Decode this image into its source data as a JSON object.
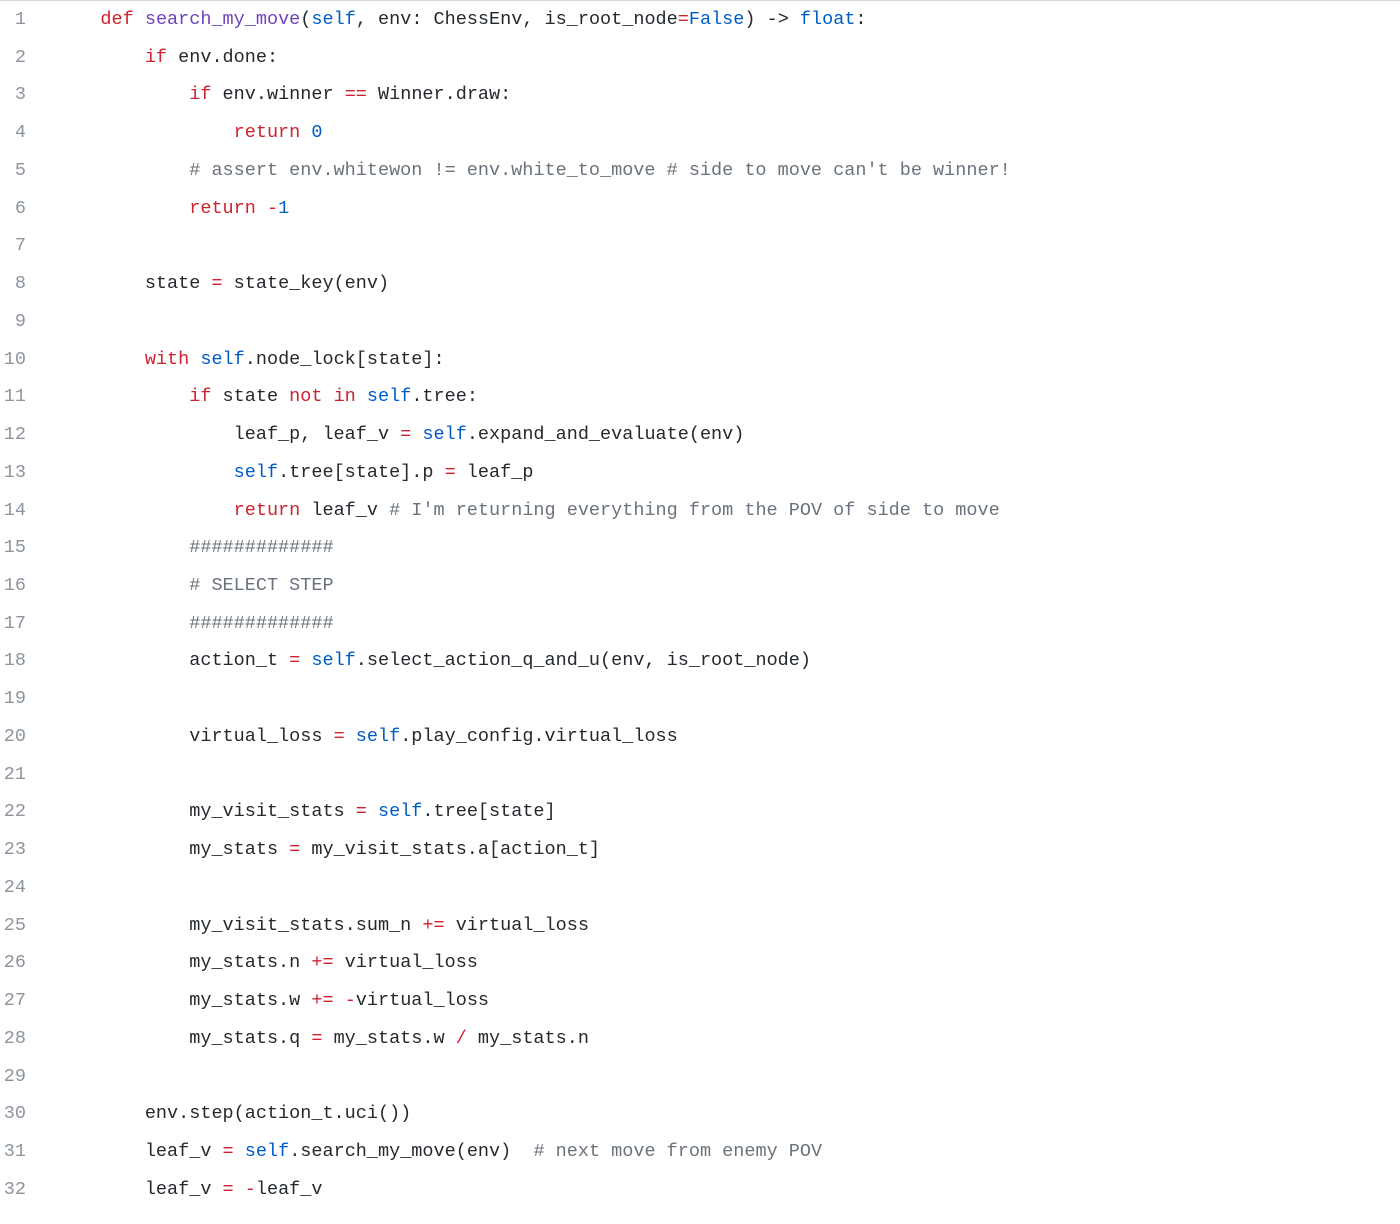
{
  "line_numbers": [
    "1",
    "2",
    "3",
    "4",
    "5",
    "6",
    "7",
    "8",
    "9",
    "10",
    "11",
    "12",
    "13",
    "14",
    "15",
    "16",
    "17",
    "18",
    "19",
    "20",
    "21",
    "22",
    "23",
    "24",
    "25",
    "26",
    "27",
    "28",
    "29",
    "30",
    "31",
    "32"
  ],
  "code": {
    "lines": [
      {
        "indent": "    ",
        "tokens": [
          {
            "cls": "kw",
            "t": "def "
          },
          {
            "cls": "fn",
            "t": "search_my_move"
          },
          {
            "cls": "txt",
            "t": "("
          },
          {
            "cls": "self",
            "t": "self"
          },
          {
            "cls": "txt",
            "t": ", env: ChessEnv, is_root_node"
          },
          {
            "cls": "op",
            "t": "="
          },
          {
            "cls": "const",
            "t": "False"
          },
          {
            "cls": "txt",
            "t": ") -> "
          },
          {
            "cls": "const",
            "t": "float"
          },
          {
            "cls": "txt",
            "t": ":"
          }
        ]
      },
      {
        "indent": "        ",
        "tokens": [
          {
            "cls": "kw",
            "t": "if"
          },
          {
            "cls": "txt",
            "t": " env.done:"
          }
        ]
      },
      {
        "indent": "            ",
        "tokens": [
          {
            "cls": "kw",
            "t": "if"
          },
          {
            "cls": "txt",
            "t": " env.winner "
          },
          {
            "cls": "op",
            "t": "=="
          },
          {
            "cls": "txt",
            "t": " Winner.draw:"
          }
        ]
      },
      {
        "indent": "                ",
        "tokens": [
          {
            "cls": "kw",
            "t": "return "
          },
          {
            "cls": "num",
            "t": "0"
          }
        ]
      },
      {
        "indent": "            ",
        "tokens": [
          {
            "cls": "cmt",
            "t": "# assert env.whitewon != env.white_to_move # side to move can't be winner!"
          }
        ]
      },
      {
        "indent": "            ",
        "tokens": [
          {
            "cls": "kw",
            "t": "return "
          },
          {
            "cls": "op",
            "t": "-"
          },
          {
            "cls": "num",
            "t": "1"
          }
        ]
      },
      {
        "indent": "",
        "tokens": []
      },
      {
        "indent": "        ",
        "tokens": [
          {
            "cls": "txt",
            "t": "state "
          },
          {
            "cls": "op",
            "t": "="
          },
          {
            "cls": "txt",
            "t": " state_key(env)"
          }
        ]
      },
      {
        "indent": "",
        "tokens": []
      },
      {
        "indent": "        ",
        "tokens": [
          {
            "cls": "kw",
            "t": "with "
          },
          {
            "cls": "self",
            "t": "self"
          },
          {
            "cls": "txt",
            "t": ".node_lock[state]:"
          }
        ]
      },
      {
        "indent": "            ",
        "tokens": [
          {
            "cls": "kw",
            "t": "if"
          },
          {
            "cls": "txt",
            "t": " state "
          },
          {
            "cls": "kw",
            "t": "not in "
          },
          {
            "cls": "self",
            "t": "self"
          },
          {
            "cls": "txt",
            "t": ".tree:"
          }
        ]
      },
      {
        "indent": "                ",
        "tokens": [
          {
            "cls": "txt",
            "t": "leaf_p, leaf_v "
          },
          {
            "cls": "op",
            "t": "="
          },
          {
            "cls": "txt",
            "t": " "
          },
          {
            "cls": "self",
            "t": "self"
          },
          {
            "cls": "txt",
            "t": ".expand_and_evaluate(env)"
          }
        ]
      },
      {
        "indent": "                ",
        "tokens": [
          {
            "cls": "self",
            "t": "self"
          },
          {
            "cls": "txt",
            "t": ".tree[state].p "
          },
          {
            "cls": "op",
            "t": "="
          },
          {
            "cls": "txt",
            "t": " leaf_p"
          }
        ]
      },
      {
        "indent": "                ",
        "tokens": [
          {
            "cls": "kw",
            "t": "return"
          },
          {
            "cls": "txt",
            "t": " leaf_v "
          },
          {
            "cls": "cmt",
            "t": "# I'm returning everything from the POV of side to move"
          }
        ]
      },
      {
        "indent": "            ",
        "tokens": [
          {
            "cls": "cmt",
            "t": "#############"
          }
        ]
      },
      {
        "indent": "            ",
        "tokens": [
          {
            "cls": "cmt",
            "t": "# SELECT STEP"
          }
        ]
      },
      {
        "indent": "            ",
        "tokens": [
          {
            "cls": "cmt",
            "t": "#############"
          }
        ]
      },
      {
        "indent": "            ",
        "tokens": [
          {
            "cls": "txt",
            "t": "action_t "
          },
          {
            "cls": "op",
            "t": "="
          },
          {
            "cls": "txt",
            "t": " "
          },
          {
            "cls": "self",
            "t": "self"
          },
          {
            "cls": "txt",
            "t": ".select_action_q_and_u(env, is_root_node)"
          }
        ]
      },
      {
        "indent": "",
        "tokens": []
      },
      {
        "indent": "            ",
        "tokens": [
          {
            "cls": "txt",
            "t": "virtual_loss "
          },
          {
            "cls": "op",
            "t": "="
          },
          {
            "cls": "txt",
            "t": " "
          },
          {
            "cls": "self",
            "t": "self"
          },
          {
            "cls": "txt",
            "t": ".play_config.virtual_loss"
          }
        ]
      },
      {
        "indent": "",
        "tokens": []
      },
      {
        "indent": "            ",
        "tokens": [
          {
            "cls": "txt",
            "t": "my_visit_stats "
          },
          {
            "cls": "op",
            "t": "="
          },
          {
            "cls": "txt",
            "t": " "
          },
          {
            "cls": "self",
            "t": "self"
          },
          {
            "cls": "txt",
            "t": ".tree[state]"
          }
        ]
      },
      {
        "indent": "            ",
        "tokens": [
          {
            "cls": "txt",
            "t": "my_stats "
          },
          {
            "cls": "op",
            "t": "="
          },
          {
            "cls": "txt",
            "t": " my_visit_stats.a[action_t]"
          }
        ]
      },
      {
        "indent": "",
        "tokens": []
      },
      {
        "indent": "            ",
        "tokens": [
          {
            "cls": "txt",
            "t": "my_visit_stats.sum_n "
          },
          {
            "cls": "op",
            "t": "+="
          },
          {
            "cls": "txt",
            "t": " virtual_loss"
          }
        ]
      },
      {
        "indent": "            ",
        "tokens": [
          {
            "cls": "txt",
            "t": "my_stats.n "
          },
          {
            "cls": "op",
            "t": "+="
          },
          {
            "cls": "txt",
            "t": " virtual_loss"
          }
        ]
      },
      {
        "indent": "            ",
        "tokens": [
          {
            "cls": "txt",
            "t": "my_stats.w "
          },
          {
            "cls": "op",
            "t": "+="
          },
          {
            "cls": "txt",
            "t": " "
          },
          {
            "cls": "op",
            "t": "-"
          },
          {
            "cls": "txt",
            "t": "virtual_loss"
          }
        ]
      },
      {
        "indent": "            ",
        "tokens": [
          {
            "cls": "txt",
            "t": "my_stats.q "
          },
          {
            "cls": "op",
            "t": "="
          },
          {
            "cls": "txt",
            "t": " my_stats.w "
          },
          {
            "cls": "op",
            "t": "/"
          },
          {
            "cls": "txt",
            "t": " my_stats.n"
          }
        ]
      },
      {
        "indent": "",
        "tokens": []
      },
      {
        "indent": "        ",
        "tokens": [
          {
            "cls": "txt",
            "t": "env.step(action_t.uci())"
          }
        ]
      },
      {
        "indent": "        ",
        "tokens": [
          {
            "cls": "txt",
            "t": "leaf_v "
          },
          {
            "cls": "op",
            "t": "="
          },
          {
            "cls": "txt",
            "t": " "
          },
          {
            "cls": "self",
            "t": "self"
          },
          {
            "cls": "txt",
            "t": ".search_my_move(env)  "
          },
          {
            "cls": "cmt",
            "t": "# next move from enemy POV"
          }
        ]
      },
      {
        "indent": "        ",
        "tokens": [
          {
            "cls": "txt",
            "t": "leaf_v "
          },
          {
            "cls": "op",
            "t": "="
          },
          {
            "cls": "txt",
            "t": " "
          },
          {
            "cls": "op",
            "t": "-"
          },
          {
            "cls": "txt",
            "t": "leaf_v"
          }
        ]
      }
    ]
  }
}
